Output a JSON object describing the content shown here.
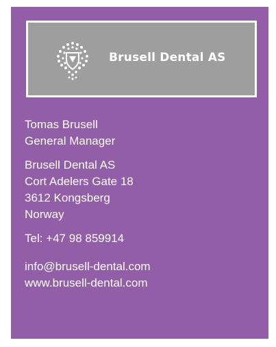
{
  "logo": {
    "company_name": "Brusell Dental AS"
  },
  "contact": {
    "name": "Tomas Brusell",
    "title": "General Manager"
  },
  "address": {
    "company": "Brusell Dental AS",
    "street": "Cort Adelers Gate 18",
    "postal_city": "3612 Kongsberg",
    "country": "Norway"
  },
  "phone": {
    "line": "Tel: +47 98 859914"
  },
  "online": {
    "email": "info@brusell-dental.com",
    "website": "www.brusell-dental.com"
  },
  "colors": {
    "card_background": "#915EA7",
    "logo_background": "#9E9E9E",
    "text": "#FFFFFF"
  }
}
